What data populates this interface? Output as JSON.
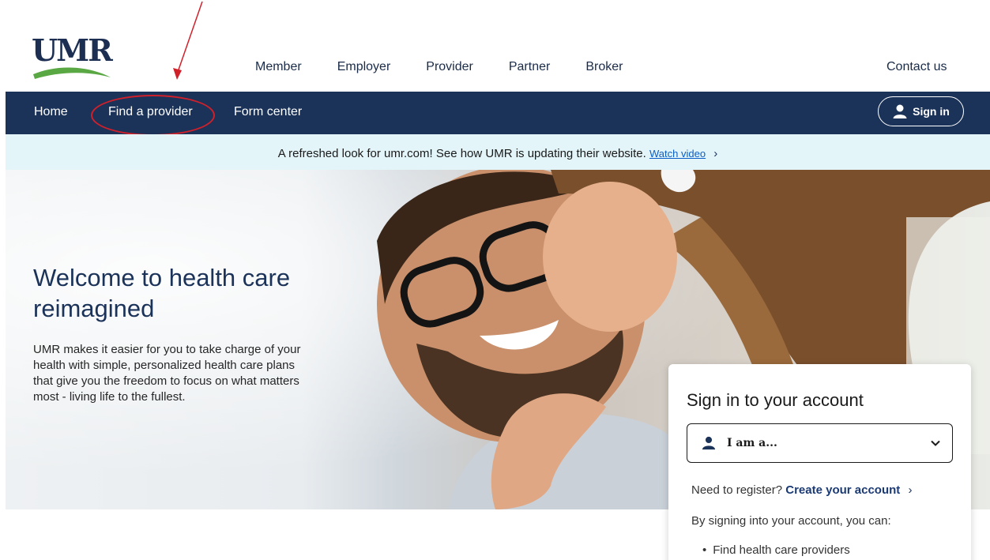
{
  "logo": {
    "text": "UMR",
    "swoosh_color": "#5aa844"
  },
  "audience_nav": [
    "Member",
    "Employer",
    "Provider",
    "Partner",
    "Broker"
  ],
  "contact_label": "Contact us",
  "primary_nav": {
    "home": "Home",
    "find_provider": "Find a provider",
    "form_center": "Form center",
    "sign_in": "Sign in"
  },
  "banner": {
    "text": "A refreshed look for umr.com! See how UMR is updating their website.",
    "link": "Watch video",
    "chevron": "›"
  },
  "hero": {
    "title": "Welcome to health care reimagined",
    "body": "UMR makes it easier for you to take charge of your health with simple, personalized health care plans that give you the freedom to focus on what matters most - living life to the fullest."
  },
  "signin_card": {
    "title": "Sign in to your account",
    "role_selected": "I am a...",
    "register_prompt": "Need to register?",
    "register_link": "Create your account",
    "chevron": "›",
    "benefit_intro": "By signing into your account, you can:",
    "benefits": [
      "Find health care providers"
    ]
  },
  "colors": {
    "navy": "#1b3259",
    "banner_bg": "#e3f5f9",
    "annotation_red": "#d0202a",
    "link_blue": "#0b5ec7"
  },
  "icons": [
    "user-icon",
    "chevron-down-icon",
    "chevron-right-icon"
  ]
}
